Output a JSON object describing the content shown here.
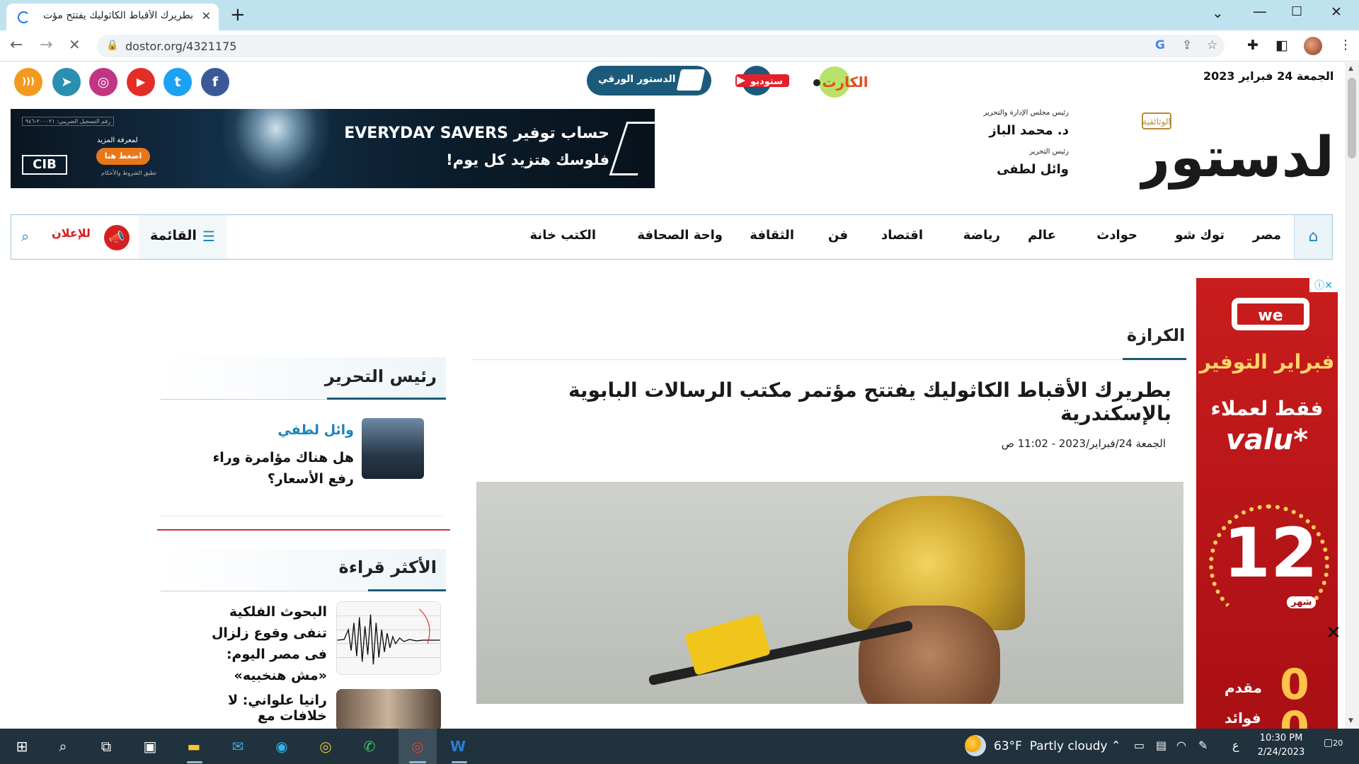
{
  "browser": {
    "tab_title": "بطريرك الأقباط الكاثوليك يفتتح مؤت",
    "url": "dostor.org/4321175",
    "controls": {
      "minimize": "—",
      "maximize": "☐",
      "close": "✕",
      "dropdown": "⌄",
      "new_tab": "+"
    }
  },
  "topbar": {
    "date": "الجمعة 24 فبراير 2023",
    "paper_button": "الدستور الورقي",
    "studio_logo_text": "ستوديو",
    "karn_logo_text": "الكارت",
    "social": [
      {
        "name": "facebook",
        "glyph": "f",
        "color": "#3b5998"
      },
      {
        "name": "twitter",
        "glyph": "t",
        "color": "#1da1f2"
      },
      {
        "name": "youtube",
        "glyph": "▶",
        "color": "#e52d27"
      },
      {
        "name": "instagram",
        "glyph": "◎",
        "color": "#c13584"
      },
      {
        "name": "telegram",
        "glyph": "➤",
        "color": "#2a8fb0"
      },
      {
        "name": "rss",
        "glyph": ")))",
        "color": "#f39a1e"
      }
    ]
  },
  "header": {
    "board_role": "رئيس مجلس الإدارة والتحرير",
    "board_name": "د. محمد الباز",
    "editor_role": "رئيس التحرير",
    "editor_name": "وائل لطفى",
    "logo_main": "الدستور",
    "logo_sub": "الوثائقية"
  },
  "ad_banner": {
    "line1": "حساب توفير EVERYDAY SAVERS",
    "line2": "فلوسك هتزيد كل يوم!",
    "more": "لمعرفة المزيد",
    "press": "اضغط هنا",
    "terms": "تطبق الشروط والأحكام",
    "reg": "رقم التسجيل الضريبي: ٢٠٠٠٢١-٩٤٦",
    "brand": "CIB"
  },
  "nav": {
    "items": [
      "مصر",
      "توك شو",
      "حوادث",
      "عالم",
      "رياضة",
      "اقتصاد",
      "فن",
      "الثقافة",
      "واحة الصحافة",
      "الكتب خانة"
    ],
    "menu_label": "القائمة",
    "ads_label": "للإعلان"
  },
  "article": {
    "section": "الكرازة",
    "headline": "بطريرك الأقباط الكاثوليك يفتتح مؤتمر مكتب الرسالات البابوية بالإسكندرية",
    "date": "الجمعة 24/فبراير/2023 - 11:02 ص"
  },
  "sidebar": {
    "editor_heading": "رئيس التحرير",
    "author_name": "وائل لطفي",
    "author_article": "هل هناك مؤامرة وراء رفع الأسعار؟",
    "most_read_heading": "الأكثر قراءة",
    "most_read": [
      {
        "title": "البحوث الفلكية تنفى وقوع زلزال فى مصر اليوم: «مش هنخبيه»"
      },
      {
        "title": "رانيا علواني: لا خلافات مع"
      }
    ]
  },
  "side_ad": {
    "logo": "we",
    "line1": "فبراير التوفير",
    "line2": "فقط لعملاء",
    "brand": "valu*",
    "months_number": "12",
    "months_label": "شهر",
    "zero1": "0",
    "zero1_label": "مقدم",
    "zero2": "0",
    "zero2_label": "فوائد"
  },
  "taskbar": {
    "weather_temp": "63°F",
    "weather_desc": "Partly cloudy",
    "time": "10:30 PM",
    "date": "2/24/2023",
    "lang": "ع",
    "notifications": "20"
  }
}
